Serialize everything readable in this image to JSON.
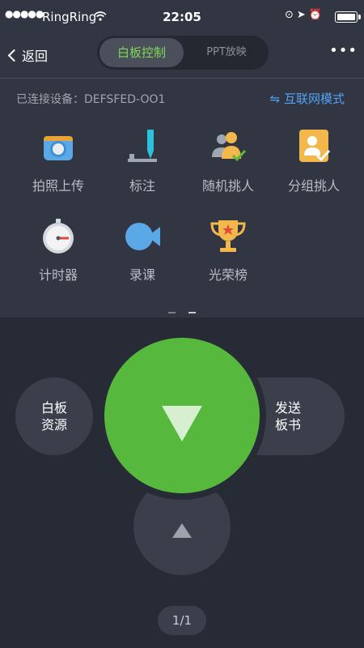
{
  "status_bar": {
    "signal": "●●●●●",
    "carrier": "RingRing",
    "time": "22:05"
  },
  "nav": {
    "back_label": "返回",
    "tab_active": "白板控制",
    "tab_inactive": "PPT放映",
    "more_label": "•••"
  },
  "device": {
    "connected_label": "已连接设备：DEFSFED-OO1",
    "mode_label": "互联网模式"
  },
  "tools": [
    {
      "label": "拍照上传",
      "icon": "camera-icon"
    },
    {
      "label": "标注",
      "icon": "marker-icon"
    },
    {
      "label": "随机挑人",
      "icon": "random-pick-icon"
    },
    {
      "label": "分组挑人",
      "icon": "group-pick-icon"
    },
    {
      "label": "计时器",
      "icon": "timer-icon"
    },
    {
      "label": "录课",
      "icon": "video-record-icon"
    },
    {
      "label": "光荣榜",
      "icon": "trophy-icon"
    }
  ],
  "controls": {
    "board_resources": [
      "白板",
      "资源"
    ],
    "send_board": [
      "发送",
      "板书"
    ]
  },
  "page_indicator": "1/1",
  "colors": {
    "accent_green": "#57b83e",
    "accent_blue": "#4fa3f7",
    "tab_active_text": "#7ed957"
  }
}
